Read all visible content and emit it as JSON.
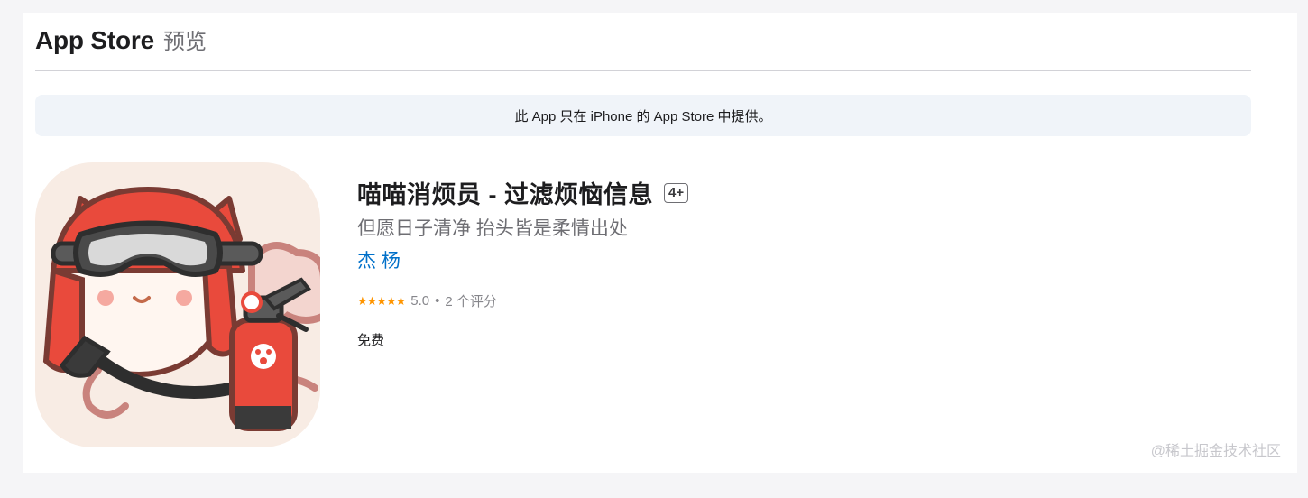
{
  "header": {
    "brand": "App Store",
    "preview": "预览"
  },
  "notice": {
    "text": "此 App 只在 iPhone 的 App Store 中提供。"
  },
  "app": {
    "icon": "fire-extinguisher-cat-app-icon",
    "title": "喵喵消烦员 - 过滤烦恼信息",
    "age_rating": "4+",
    "subtitle": "但愿日子清净 抬头皆是柔情出处",
    "developer": "杰 杨",
    "stars": "★★★★★",
    "rating_score": "5.0",
    "rating_separator": "•",
    "rating_count": "2 个评分",
    "price": "免费"
  },
  "watermark": {
    "text": "@稀土掘金技术社区"
  },
  "colors": {
    "link": "#0070c9",
    "star": "#ff9500",
    "notice_bg": "#f0f4f9",
    "icon_bg": "#f8ece4",
    "accent_red": "#e94a3c"
  }
}
